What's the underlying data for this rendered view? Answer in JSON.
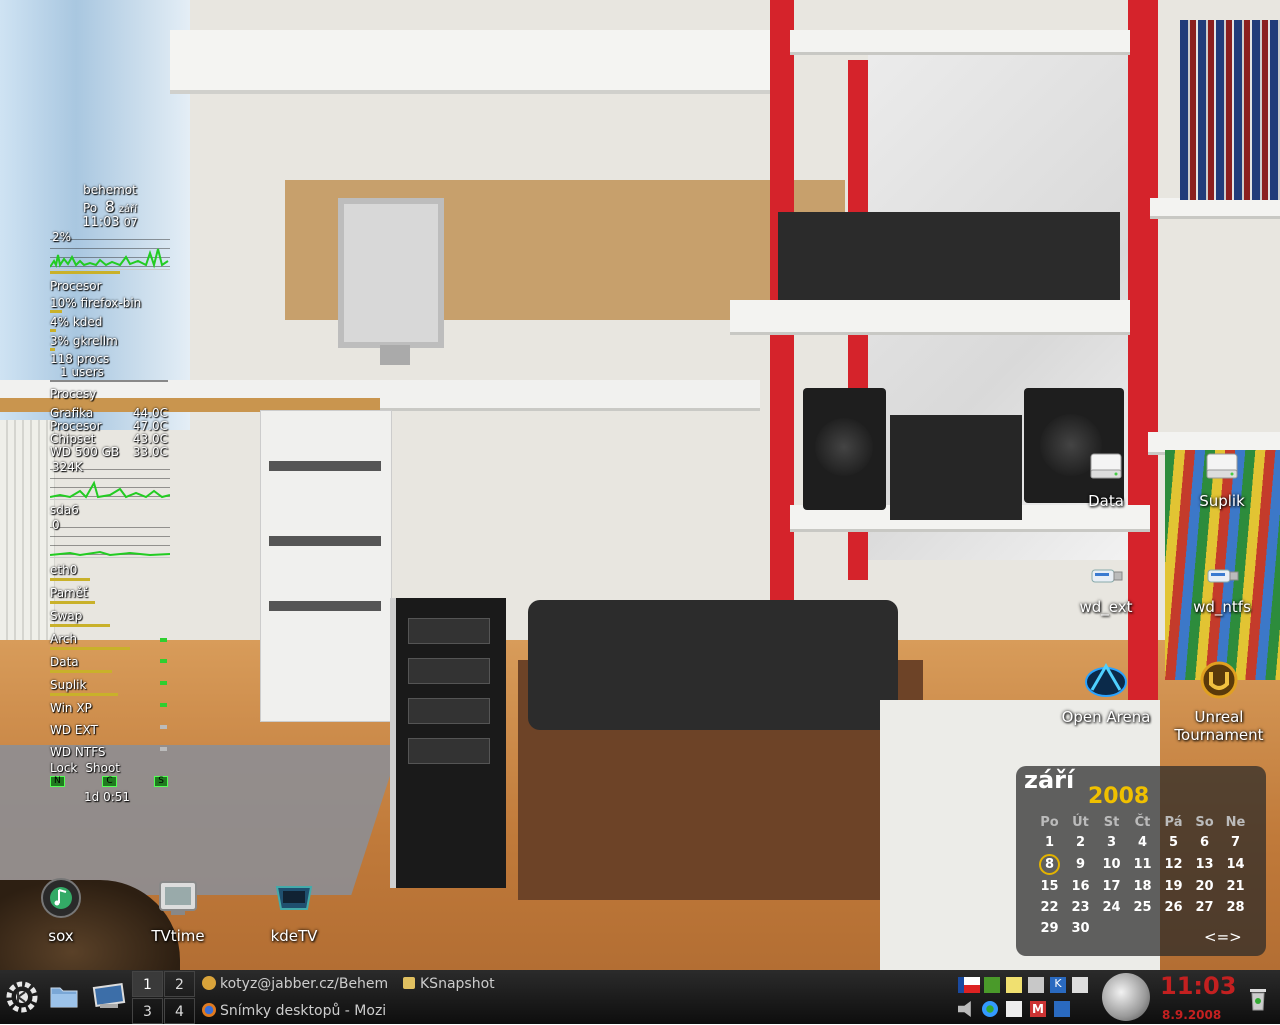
{
  "sysmon": {
    "hostname": "behemot",
    "weekday": "Po",
    "day": "8",
    "month": "září",
    "time": "11:03",
    "seconds": "07",
    "cpu_percent": "2%",
    "procesor_label": "Procesor",
    "proc1": "10% firefox-bin",
    "proc2": "4% kded",
    "proc3": "3% gkrellm",
    "procs": "118 procs",
    "users": "1 users",
    "procesy_label": "Procesy",
    "temps": [
      {
        "name": "Grafika",
        "value": "44.0C"
      },
      {
        "name": "Procesor",
        "value": "47.0C"
      },
      {
        "name": "Chipset",
        "value": "43.0C"
      },
      {
        "name": "WD 500 GB",
        "value": "33.0C"
      }
    ],
    "disk_rate": "324K",
    "sda_label": "sda6",
    "sda_rate": "0",
    "eth_label": "eth0",
    "mem_label": "Paměť",
    "swap_label": "Swap",
    "mounts": [
      "Arch",
      "Data",
      "Suplik",
      "Win XP",
      "WD EXT",
      "WD NTFS"
    ],
    "lock_label": "Lock",
    "shoot_label": "Shoot",
    "keys": [
      "N",
      "C",
      "S"
    ],
    "uptime": "1d  0:51"
  },
  "desktop_icons": {
    "data": "Data",
    "suplik": "Suplik",
    "wd_ext": "wd_ext",
    "wd_ntfs": "wd_ntfs",
    "open_arena": "Open Arena",
    "unreal_1": "Unreal",
    "unreal_2": "Tournament",
    "sox": "sox",
    "tvtime": "TVtime",
    "kdetv": "kdeTV"
  },
  "calendar": {
    "month": "září",
    "year": "2008",
    "weekdays": [
      "Po",
      "Út",
      "St",
      "Čt",
      "Pá",
      "So",
      "Ne"
    ],
    "today": "8",
    "nav": "<=>",
    "rows": [
      [
        "1",
        "2",
        "3",
        "4",
        "5",
        "6",
        "7"
      ],
      [
        "8",
        "9",
        "10",
        "11",
        "12",
        "13",
        "14"
      ],
      [
        "15",
        "16",
        "17",
        "18",
        "19",
        "20",
        "21"
      ],
      [
        "22",
        "23",
        "24",
        "25",
        "26",
        "27",
        "28"
      ],
      [
        "29",
        "30",
        "",
        "",
        "",
        "",
        ""
      ]
    ]
  },
  "taskbar": {
    "desktops": [
      "1",
      "2",
      "3",
      "4"
    ],
    "tasks": [
      "kotyz@jabber.cz/Behem",
      "KSnapshot",
      "Snímky desktopů - Mozi"
    ],
    "clock": "11:03",
    "date": "8.9.2008"
  },
  "colors": {
    "clock": "#c32020",
    "year": "#f0c000",
    "bar": "#c9b12a",
    "graph": "#22cc22"
  }
}
